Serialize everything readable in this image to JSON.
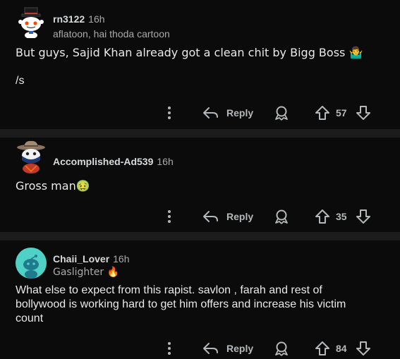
{
  "comments": [
    {
      "username": "rn3122",
      "time": "16h",
      "flair": "aflatoon, hai thoda cartoon",
      "body_lines": [
        "But guys, Sajid Khan already got a clean chit by Bigg Boss 🤷‍♂️",
        "",
        "/s"
      ],
      "reply_label": "Reply",
      "score": "57",
      "avatar": "snoo-top-hat-avatar"
    },
    {
      "username": "Accomplished-Ad539",
      "time": "16h",
      "flair": "",
      "body_lines": [
        "Gross man🤢"
      ],
      "reply_label": "Reply",
      "score": "35",
      "avatar": "snoo-cowboy-avatar"
    },
    {
      "username": "Chaii_Lover",
      "time": "16h",
      "flair": "Gaslighter 🔥",
      "body_lines": [
        "What else to expect from this rapist. savlon , farah and rest of",
        "bollywood is working hard to get him offers and increase his victim",
        "count"
      ],
      "reply_label": "Reply",
      "score": "84",
      "avatar": "snoo-default-avatar"
    }
  ],
  "icons": {
    "more": "more-vertical-icon",
    "reply": "reply-arrow-icon",
    "award": "award-icon",
    "upvote": "upvote-arrow-icon",
    "downvote": "downvote-arrow-icon"
  },
  "colors": {
    "background": "#000000",
    "card": "#0b0b0b",
    "divider": "#1c1c1c",
    "text": "#d7dadc",
    "muted": "#a8aaab",
    "avatar_teal": "#4fd1c5"
  }
}
